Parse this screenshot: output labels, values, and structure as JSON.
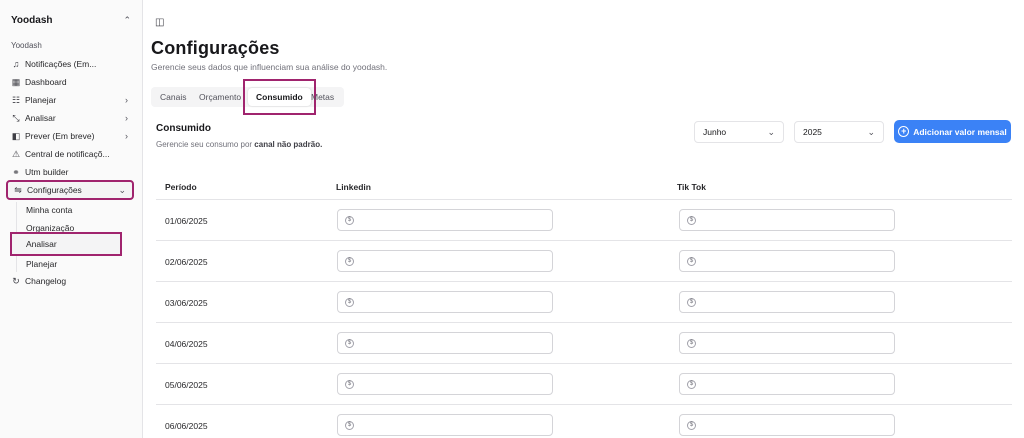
{
  "sidebar": {
    "brand": "Yoodash",
    "section": "Yoodash",
    "items": [
      {
        "label": "Notificações (Em...",
        "icon": "bell-icon"
      },
      {
        "label": "Dashboard",
        "icon": "dashboard-icon"
      },
      {
        "label": "Planejar",
        "icon": "plan-icon"
      },
      {
        "label": "Analisar",
        "icon": "chart-icon"
      },
      {
        "label": "Prever (Em breve)",
        "icon": "forecast-icon"
      },
      {
        "label": "Central de notificaçõ...",
        "icon": "warning-icon"
      },
      {
        "label": "Utm builder",
        "icon": "link-icon"
      },
      {
        "label": "Configurações",
        "icon": "settings-sliders-icon"
      }
    ],
    "sub_items": [
      "Minha conta",
      "Organização",
      "Analisar",
      "Planejar"
    ],
    "changelog": "Changelog"
  },
  "page": {
    "title": "Configurações",
    "subtitle": "Gerencie seus dados que influenciam sua análise do yoodash."
  },
  "tabs": [
    "Canais",
    "Orçamento",
    "Consumido",
    "Metas"
  ],
  "section": {
    "title": "Consumido",
    "desc_prefix": "Gerencie seu consumo por",
    "desc_bold": "canal não padrão."
  },
  "filters": {
    "month": "Junho",
    "year": "2025",
    "add_button": "Adicionar valor mensal"
  },
  "table": {
    "headers": [
      "Período",
      "Linkedin",
      "Tik Tok"
    ],
    "rows": [
      "01/06/2025",
      "02/06/2025",
      "03/06/2025",
      "04/06/2025",
      "05/06/2025",
      "06/06/2025"
    ]
  },
  "colors": {
    "accent": "#3b82f6",
    "highlight": "#a0246e"
  }
}
